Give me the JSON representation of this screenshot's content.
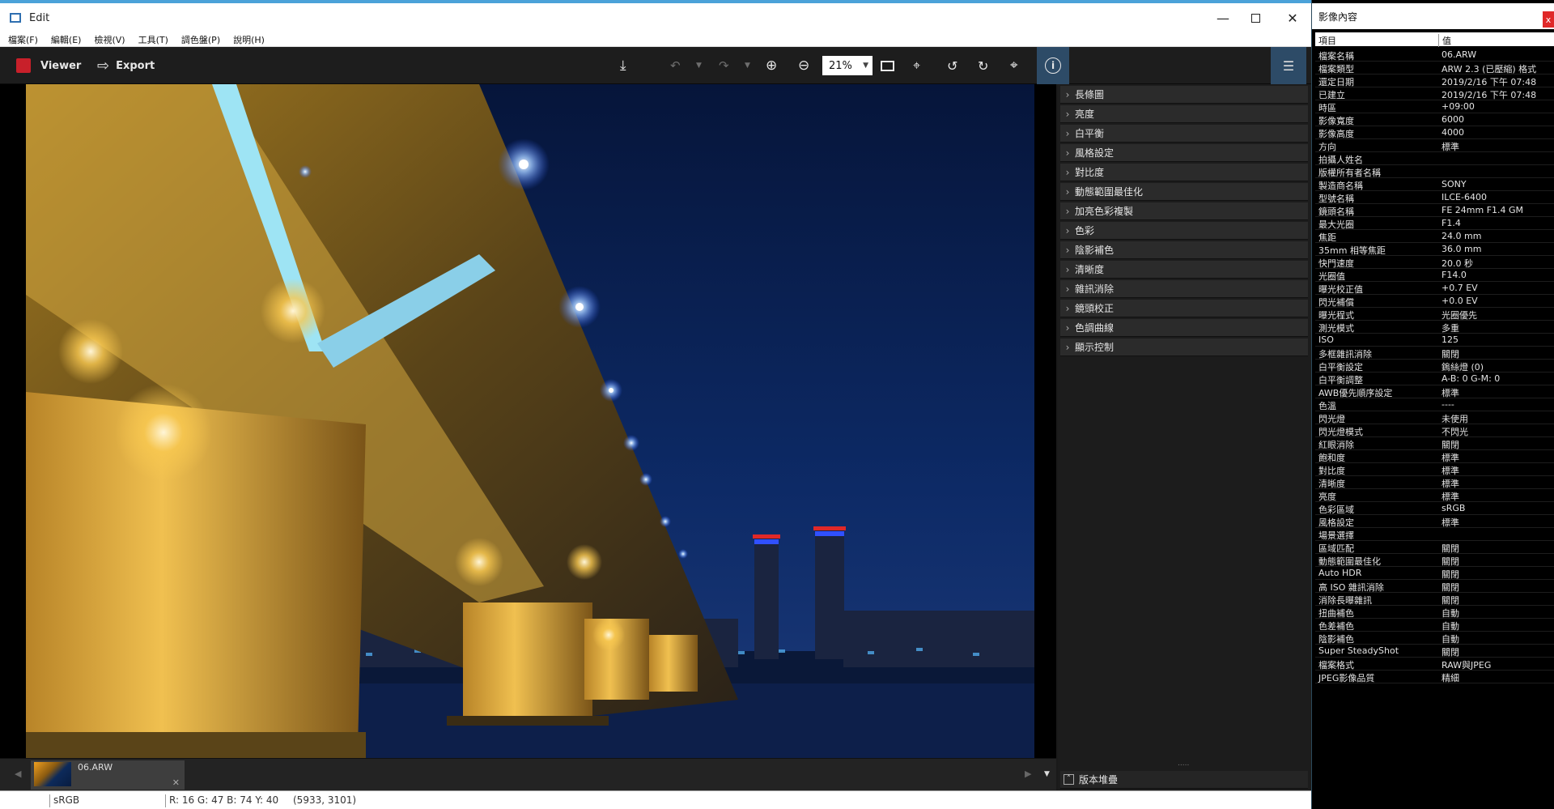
{
  "window": {
    "title": "Edit"
  },
  "menu": [
    "檔案(F)",
    "編輯(E)",
    "檢視(V)",
    "工具(T)",
    "調色盤(P)",
    "說明(H)"
  ],
  "toolbar": {
    "viewer_label": "Viewer",
    "export_label": "Export",
    "zoom_value": "21%"
  },
  "adjust_panel": {
    "sections": [
      "長條圖",
      "亮度",
      "白平衡",
      "風格設定",
      "對比度",
      "動態範圍最佳化",
      "加亮色彩複製",
      "色彩",
      "陰影補色",
      "清晰度",
      "雜訊消除",
      "鏡頭校正",
      "色調曲線",
      "顯示控制"
    ],
    "version_stack_label": "版本堆疊",
    "grip": "....."
  },
  "filmstrip": {
    "filename": "06.ARW"
  },
  "status": {
    "colorspace": "sRGB",
    "pixel_info": "R: 16  G: 47  B: 74  Y: 40",
    "coords": "(5933, 3101)"
  },
  "info_panel": {
    "title": "影像內容",
    "close": "x",
    "col_item": "項目",
    "col_value": "值",
    "rows": [
      [
        "檔案名稱",
        "06.ARW"
      ],
      [
        "檔案類型",
        "ARW 2.3 (已壓縮) 格式"
      ],
      [
        "還定日期",
        "2019/2/16 下午 07:48"
      ],
      [
        "已建立",
        "2019/2/16 下午 07:48"
      ],
      [
        "時區",
        "+09:00"
      ],
      [
        "影像寬度",
        "6000"
      ],
      [
        "影像高度",
        "4000"
      ],
      [
        "方向",
        "標準"
      ],
      [
        "拍攝人姓名",
        ""
      ],
      [
        "版權所有者名稱",
        ""
      ],
      [
        "製造商名稱",
        "SONY"
      ],
      [
        "型號名稱",
        "ILCE-6400"
      ],
      [
        "鏡頭名稱",
        "FE 24mm F1.4 GM"
      ],
      [
        "最大光圈",
        "F1.4"
      ],
      [
        "焦距",
        "24.0 mm"
      ],
      [
        "35mm 相等焦距",
        "36.0 mm"
      ],
      [
        "快門速度",
        "20.0 秒"
      ],
      [
        "光圈值",
        "F14.0"
      ],
      [
        "曝光校正值",
        "+0.7 EV"
      ],
      [
        "閃光補償",
        "+0.0 EV"
      ],
      [
        "曝光程式",
        "光圈優先"
      ],
      [
        "測光模式",
        "多重"
      ],
      [
        "ISO",
        "125"
      ],
      [
        "多框雜訊消除",
        "關閉"
      ],
      [
        "白平衡設定",
        "鎢絲燈 (0)"
      ],
      [
        "白平衡調整",
        "A-B: 0 G-M: 0"
      ],
      [
        "AWB優先順序設定",
        "標準"
      ],
      [
        "色溫",
        "----"
      ],
      [
        "閃光燈",
        "未使用"
      ],
      [
        "閃光燈模式",
        "不閃光"
      ],
      [
        "紅眼消除",
        "關閉"
      ],
      [
        "飽和度",
        "標準"
      ],
      [
        "對比度",
        "標準"
      ],
      [
        "清晰度",
        "標準"
      ],
      [
        "亮度",
        "標準"
      ],
      [
        "色彩區域",
        "sRGB"
      ],
      [
        "風格設定",
        "標準"
      ],
      [
        "場景選擇",
        ""
      ],
      [
        "區域匹配",
        "關閉"
      ],
      [
        "動態範圍最佳化",
        "關閉"
      ],
      [
        "Auto HDR",
        "關閉"
      ],
      [
        "高 ISO 雜訊消除",
        "關閉"
      ],
      [
        "消除長曝雜訊",
        "關閉"
      ],
      [
        "扭曲補色",
        "自動"
      ],
      [
        "色差補色",
        "自動"
      ],
      [
        "陰影補色",
        "自動"
      ],
      [
        "Super SteadyShot",
        "關閉"
      ],
      [
        "檔案格式",
        "RAW與JPEG"
      ],
      [
        "JPEG影像品質",
        "精細"
      ]
    ]
  }
}
